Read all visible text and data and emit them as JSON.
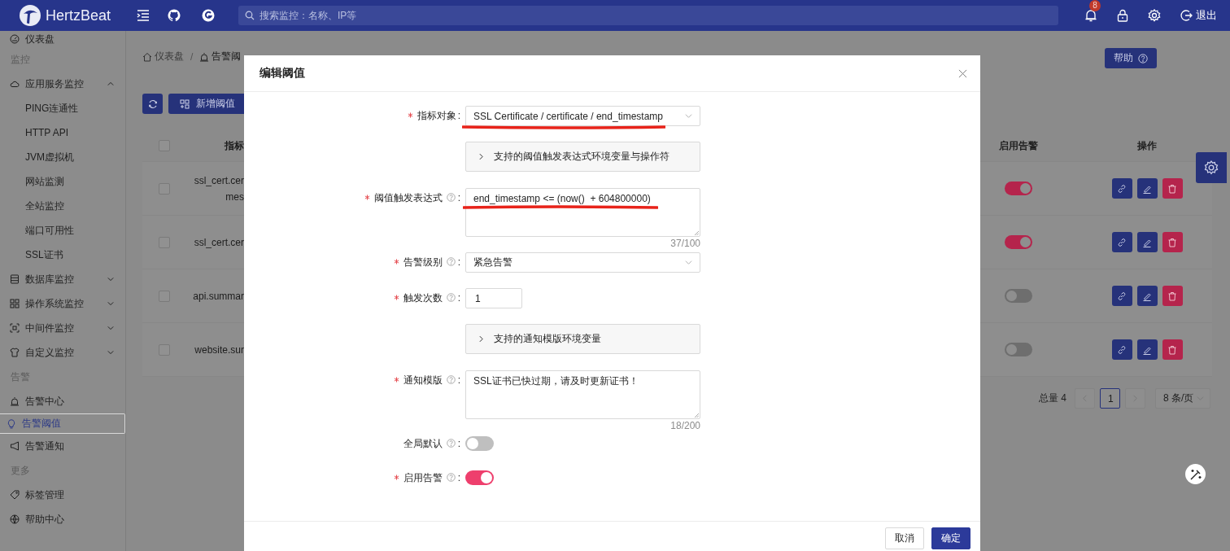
{
  "header": {
    "logo_text": "HertzBeat",
    "search_placeholder": "搜索监控：名称、IP等",
    "notification_count": "8",
    "logout": "退出"
  },
  "sidebar": {
    "items": [
      {
        "kind": "item",
        "label": "仪表盘",
        "selected": false
      },
      {
        "kind": "section",
        "label": "监控"
      },
      {
        "kind": "menu",
        "label": "应用服务监控",
        "selected": false,
        "expanded": true,
        "children": [
          {
            "label": "PING连通性",
            "selected": false
          },
          {
            "label": "HTTP API",
            "selected": false
          },
          {
            "label": "JVM虚拟机",
            "selected": false
          },
          {
            "label": "网站监测",
            "selected": false
          },
          {
            "label": "全站监控",
            "selected": false
          },
          {
            "label": "端口可用性",
            "selected": false
          },
          {
            "label": "SSL证书",
            "selected": false
          }
        ]
      },
      {
        "kind": "menu",
        "label": "数据库监控",
        "selected": false,
        "expanded": false
      },
      {
        "kind": "menu",
        "label": "操作系统监控",
        "selected": false,
        "expanded": false
      },
      {
        "kind": "menu",
        "label": "中间件监控",
        "selected": false,
        "expanded": false
      },
      {
        "kind": "menu",
        "label": "自定义监控",
        "selected": false,
        "expanded": false
      },
      {
        "kind": "section",
        "label": "告警"
      },
      {
        "kind": "item",
        "label": "告警中心",
        "selected": false
      },
      {
        "kind": "item",
        "label": "告警阈值",
        "selected": true
      },
      {
        "kind": "item",
        "label": "告警通知",
        "selected": false
      },
      {
        "kind": "section",
        "label": "更多"
      },
      {
        "kind": "item",
        "label": "标签管理",
        "selected": false
      },
      {
        "kind": "item",
        "label": "帮助中心",
        "selected": false
      }
    ]
  },
  "breadcrumb": [
    {
      "label": "仪表盘"
    },
    {
      "label": "告警阈"
    }
  ],
  "breadcrumb_separator": "/",
  "help_button": "帮助",
  "toolbar": {
    "add_button": "新增阈值"
  },
  "table": {
    "columns": [
      "指标",
      "启用告警",
      "操作"
    ],
    "header_checked": false,
    "rows": [
      {
        "checked": false,
        "metric": [
          "ssl_cert.cer",
          "mes"
        ],
        "enabled": true
      },
      {
        "checked": false,
        "metric": [
          "ssl_cert.cer"
        ],
        "enabled": true
      },
      {
        "checked": false,
        "metric": [
          "api.summar"
        ],
        "enabled": false
      },
      {
        "checked": false,
        "metric": [
          "website.sur"
        ],
        "enabled": false
      }
    ]
  },
  "pagination": {
    "total": "总量 4",
    "pages": [
      {
        "label": "1",
        "selected": true
      }
    ],
    "page_size": "8 条/页"
  },
  "dialog": {
    "title": "编辑阈值",
    "fields": [
      {
        "kind": "select",
        "label": "指标对象",
        "required": true,
        "help": false,
        "colon": ":",
        "value": "SSL Certificate / certificate / end_timestamp",
        "annotated": true
      },
      {
        "kind": "collapse",
        "label": "支持的阈值触发表达式环境变量与操作符",
        "expanded": false
      },
      {
        "kind": "textarea",
        "label": "阈值触发表达式",
        "required": true,
        "help": true,
        "colon": ":",
        "value": "end_timestamp <= (now()  + 604800000)",
        "counter": "37/100",
        "annotated": true
      },
      {
        "kind": "select",
        "label": "告警级别",
        "required": true,
        "help": true,
        "colon": ":",
        "value": "紧急告警",
        "annotated": false
      },
      {
        "kind": "number",
        "label": "触发次数",
        "required": true,
        "help": true,
        "colon": ":",
        "value": "1"
      },
      {
        "kind": "collapse",
        "label": "支持的通知模版环境变量",
        "expanded": false
      },
      {
        "kind": "textarea",
        "label": "通知模版",
        "required": true,
        "help": true,
        "colon": ":",
        "value": "SSL证书已快过期，请及时更新证书！",
        "counter": "18/200",
        "annotated": false
      },
      {
        "kind": "switch",
        "label": "全局默认",
        "required": false,
        "help": true,
        "colon": ":",
        "on": false
      },
      {
        "kind": "switch",
        "label": "启用告警",
        "required": true,
        "help": true,
        "colon": ":",
        "on": true
      }
    ],
    "buttons": [
      {
        "label": "取消",
        "primary": false
      },
      {
        "label": "确定",
        "primary": true
      }
    ]
  }
}
